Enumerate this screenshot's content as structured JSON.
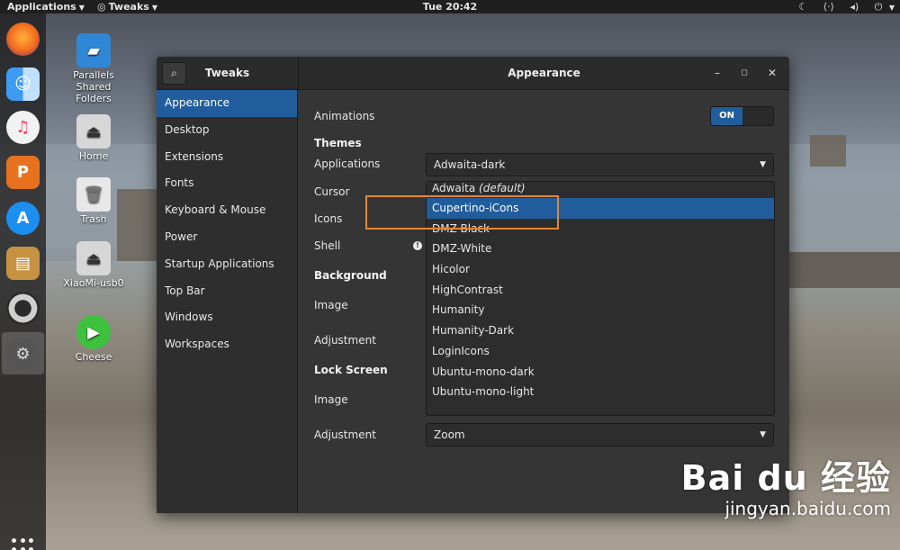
{
  "topbar": {
    "applications_label": "Applications",
    "active_app_label": "Tweaks",
    "clock": "Tue 20:42"
  },
  "desktop": {
    "icons": [
      {
        "label": "Parallels Shared Folders"
      },
      {
        "label": "Home"
      },
      {
        "label": "Trash"
      },
      {
        "label": "XiaoMi-usb0"
      },
      {
        "label": "Cheese"
      }
    ]
  },
  "dock": {
    "apps": [
      "firefox-icon",
      "finder-icon",
      "music-icon",
      "wps-presentation-icon",
      "app-store-icon",
      "files-icon",
      "lifesaver-icon",
      "settings-icon"
    ]
  },
  "window": {
    "left_title": "Tweaks",
    "title": "Appearance",
    "sidebar": [
      {
        "label": "Appearance"
      },
      {
        "label": "Desktop"
      },
      {
        "label": "Extensions"
      },
      {
        "label": "Fonts"
      },
      {
        "label": "Keyboard & Mouse"
      },
      {
        "label": "Power"
      },
      {
        "label": "Startup Applications"
      },
      {
        "label": "Top Bar"
      },
      {
        "label": "Windows"
      },
      {
        "label": "Workspaces"
      }
    ],
    "content": {
      "animations_label": "Animations",
      "animations_toggle": "ON",
      "themes_heading": "Themes",
      "applications_label": "Applications",
      "applications_value": "Adwaita-dark",
      "cursor_label": "Cursor",
      "icons_label": "Icons",
      "shell_label": "Shell",
      "background_heading": "Background",
      "image_label": "Image",
      "adjustment_label": "Adjustment",
      "lock_screen_heading": "Lock Screen",
      "lock_image_label": "Image",
      "lock_adjustment_label": "Adjustment",
      "lock_adjustment_value": "Zoom"
    },
    "dropdown": [
      {
        "label": "Adwaita",
        "suffix": "(default)"
      },
      {
        "label": "Cupertino-iCons"
      },
      {
        "label": "DMZ-Black"
      },
      {
        "label": "DMZ-White"
      },
      {
        "label": "Hicolor"
      },
      {
        "label": "HighContrast"
      },
      {
        "label": "Humanity"
      },
      {
        "label": "Humanity-Dark"
      },
      {
        "label": "LoginIcons"
      },
      {
        "label": "Ubuntu-mono-dark"
      },
      {
        "label": "Ubuntu-mono-light"
      }
    ]
  },
  "watermark": {
    "brand": "Bai du 经验",
    "url": "jingyan.baidu.com"
  },
  "colors": {
    "accent": "#215d9c",
    "highlight_box": "#e8862e"
  }
}
